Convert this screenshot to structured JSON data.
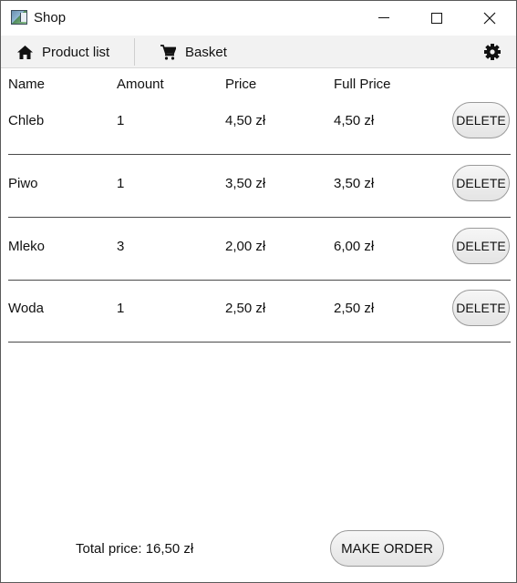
{
  "window": {
    "title": "Shop",
    "icon": "shop-app-icon"
  },
  "nav": {
    "product_list_label": "Product list",
    "basket_label": "Basket",
    "icons": {
      "product_list": "home-icon",
      "basket": "cart-icon",
      "settings": "gear-icon"
    }
  },
  "table": {
    "headers": {
      "name": "Name",
      "amount": "Amount",
      "price": "Price",
      "full_price": "Full Price"
    },
    "delete_label": "DELETE",
    "rows": [
      {
        "name": "Chleb",
        "amount": "1",
        "price": "4,50 zł",
        "full_price": "4,50 zł"
      },
      {
        "name": "Piwo",
        "amount": "1",
        "price": "3,50 zł",
        "full_price": "3,50 zł"
      },
      {
        "name": "Mleko",
        "amount": "3",
        "price": "2,00 zł",
        "full_price": "6,00 zł"
      },
      {
        "name": "Woda",
        "amount": "1",
        "price": "2,50 zł",
        "full_price": "2,50 zł"
      }
    ]
  },
  "footer": {
    "total_text": "Total price: 16,50 zł",
    "order_label": "MAKE ORDER"
  }
}
